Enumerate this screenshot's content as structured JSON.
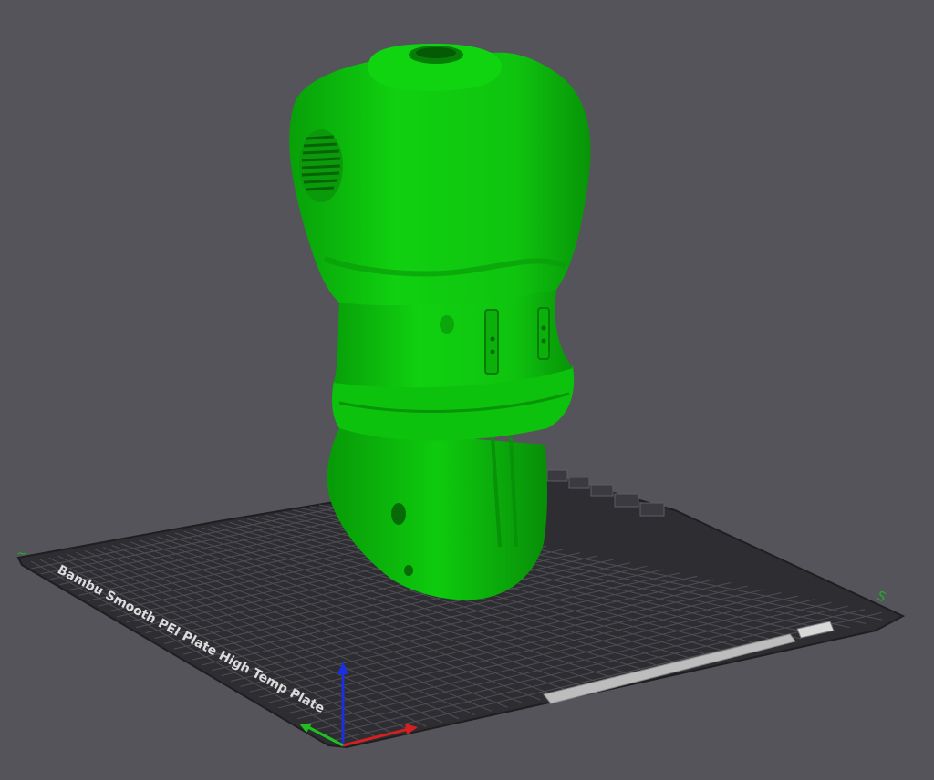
{
  "viewport": {
    "background_color": "#54545a"
  },
  "build_plate": {
    "label": "Bambu Smooth PEI Plate High Temp Plate",
    "surface_color": "#2e2e32",
    "grid_color": "#4a4a50",
    "corner_marker_left": "~",
    "corner_marker_right": "S"
  },
  "model": {
    "color": "#0dc80d",
    "shadow_color": "#079107"
  },
  "axes": {
    "x_color": "#d42020",
    "y_color": "#20c020",
    "z_color": "#1a2fe0"
  }
}
